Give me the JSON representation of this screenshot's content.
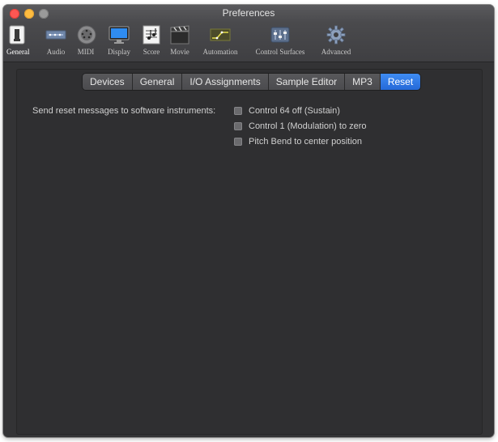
{
  "window": {
    "title": "Preferences"
  },
  "toolbar": {
    "items": [
      {
        "label": "General",
        "icon": "general-icon",
        "selected": true
      },
      {
        "label": "Audio",
        "icon": "audio-icon"
      },
      {
        "label": "MIDI",
        "icon": "midi-icon"
      },
      {
        "label": "Display",
        "icon": "display-icon"
      },
      {
        "label": "Score",
        "icon": "score-icon"
      },
      {
        "label": "Movie",
        "icon": "movie-icon"
      },
      {
        "label": "Automation",
        "icon": "automation-icon"
      },
      {
        "label": "Control Surfaces",
        "icon": "control-surfaces-icon"
      },
      {
        "label": "Advanced",
        "icon": "advanced-icon"
      }
    ]
  },
  "tabs": [
    {
      "label": "Devices"
    },
    {
      "label": "General"
    },
    {
      "label": "I/O Assignments"
    },
    {
      "label": "Sample Editor"
    },
    {
      "label": "MP3"
    },
    {
      "label": "Reset",
      "active": true
    }
  ],
  "reset": {
    "label": "Send reset messages to software instruments:",
    "options": [
      {
        "label": "Control 64 off (Sustain)",
        "checked": false
      },
      {
        "label": "Control 1 (Modulation) to zero",
        "checked": false
      },
      {
        "label": "Pitch Bend to center position",
        "checked": false
      }
    ]
  },
  "colors": {
    "accent": "#2f7ae5",
    "panel": "#2f2f31",
    "window": "#333335"
  }
}
